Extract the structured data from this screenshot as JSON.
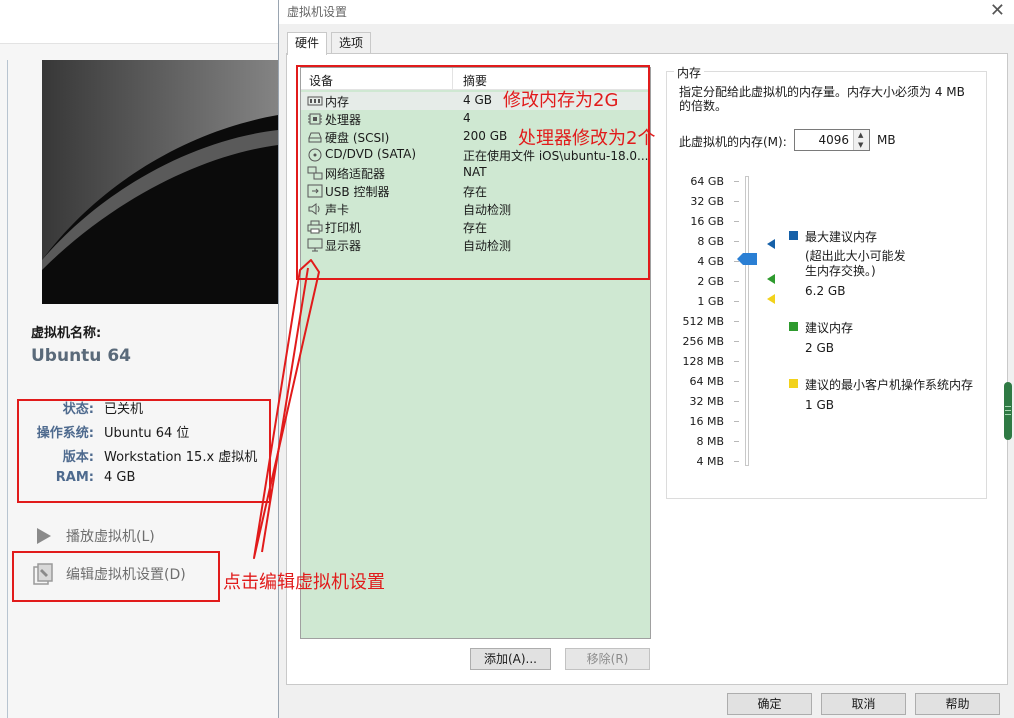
{
  "background_window": {
    "vm_name_label": "虚拟机名称:",
    "vm_name": "Ubuntu 64",
    "info": [
      {
        "key": "状态:",
        "value": "已关机"
      },
      {
        "key": "操作系统:",
        "value": "Ubuntu 64 位"
      },
      {
        "key": "版本:",
        "value": "Workstation 15.x 虚拟机"
      },
      {
        "key": "RAM:",
        "value": "4 GB"
      }
    ],
    "actions": {
      "play": {
        "label": "播放虚拟机(L)",
        "icon": "play-icon"
      },
      "edit": {
        "label": "编辑虚拟机设置(D)",
        "icon": "edit-settings-icon"
      }
    }
  },
  "dialog": {
    "title": "虚拟机设置",
    "close_glyph": "✕",
    "tabs": [
      {
        "label": "硬件",
        "active": true
      },
      {
        "label": "选项",
        "active": false
      }
    ],
    "device_list": {
      "col_device": "设备",
      "col_summary": "摘要",
      "rows": [
        {
          "icon": "memory-icon",
          "name": "内存",
          "summary": "4 GB",
          "selected": true
        },
        {
          "icon": "processor-icon",
          "name": "处理器",
          "summary": "4"
        },
        {
          "icon": "hard-disk-icon",
          "name": "硬盘 (SCSI)",
          "summary": "200 GB"
        },
        {
          "icon": "cd-dvd-icon",
          "name": "CD/DVD (SATA)",
          "summary": "正在使用文件 iOS\\ubuntu-18.0..."
        },
        {
          "icon": "network-adapter-icon",
          "name": "网络适配器",
          "summary": "NAT"
        },
        {
          "icon": "usb-controller-icon",
          "name": "USB 控制器",
          "summary": "存在"
        },
        {
          "icon": "sound-card-icon",
          "name": "声卡",
          "summary": "自动检测"
        },
        {
          "icon": "printer-icon",
          "name": "打印机",
          "summary": "存在"
        },
        {
          "icon": "display-icon",
          "name": "显示器",
          "summary": "自动检测"
        }
      ]
    },
    "add_button": "添加(A)...",
    "remove_button": "移除(R)",
    "memory": {
      "legend": "内存",
      "description": "指定分配给此虚拟机的内存量。内存大小必须为 4 MB 的倍数。",
      "field_label": "此虚拟机的内存(M):",
      "field_value": "4096",
      "unit": "MB",
      "scale": [
        "64 GB",
        "32 GB",
        "16 GB",
        "8 GB",
        "4 GB",
        "2 GB",
        "1 GB",
        "512 MB",
        "256 MB",
        "128 MB",
        "64 MB",
        "32 MB",
        "16 MB",
        "8 MB",
        "4 MB"
      ],
      "current": "4 GB",
      "legend_items": [
        {
          "color": "#1560a8",
          "title": "最大建议内存",
          "note": "(超出此大小可能发生内存交换。)",
          "value": "6.2 GB"
        },
        {
          "color": "#2e9a2e",
          "title": "建议内存",
          "value": "2 GB"
        },
        {
          "color": "#f2d21b",
          "title": "建议的最小客户机操作系统内存",
          "value": "1 GB"
        }
      ]
    },
    "footer": {
      "ok": "确定",
      "cancel": "取消",
      "help": "帮助"
    }
  },
  "annotations": {
    "color": "#e11b1b",
    "memory_note": "修改内存为2G",
    "processor_note": "处理器修改为2个",
    "click_note": "点击编辑虚拟机设置"
  }
}
